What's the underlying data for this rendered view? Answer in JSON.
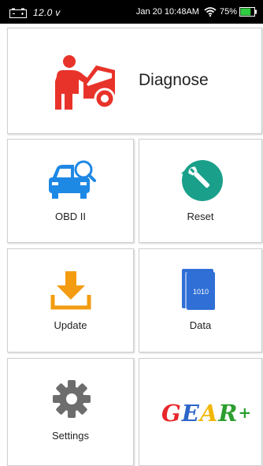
{
  "status_bar": {
    "voltage": "12.0 v",
    "datetime": "Jan 20 10:48AM",
    "battery_percent": "75%",
    "battery_level": 0.75,
    "battery_color": "#2ecc40"
  },
  "tiles": {
    "diagnose": {
      "label": "Diagnose",
      "icon": "car-mechanic-icon"
    },
    "obd2": {
      "label": "OBD II",
      "icon": "car-search-icon"
    },
    "reset": {
      "label": "Reset",
      "icon": "reset-wrench-icon"
    },
    "update": {
      "label": "Update",
      "icon": "download-icon"
    },
    "data": {
      "label": "Data",
      "icon": "data-book-icon",
      "book_text": "1010"
    },
    "settings": {
      "label": "Settings",
      "icon": "gear-icon"
    },
    "gear_plus": {
      "letters": [
        "G",
        "E",
        "A",
        "R"
      ],
      "plus": "+",
      "colors": [
        "#e8262a",
        "#2c64c8",
        "#f2b705",
        "#2c9e2f",
        "#2c9e2f"
      ]
    }
  },
  "colors": {
    "diagnose_red": "#e8332a",
    "obd_blue": "#1e88e5",
    "reset_green": "#1aa08a",
    "update_orange": "#f39c12",
    "data_blue": "#2f6fd6",
    "settings_gray": "#6d6d6d"
  }
}
